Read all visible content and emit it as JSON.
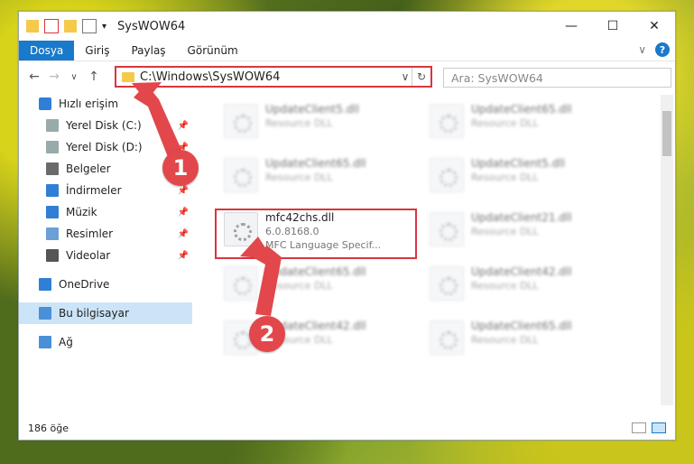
{
  "window": {
    "title": "SysWOW64",
    "minimize_symbol": "—",
    "maximize_symbol": "☐",
    "close_symbol": "✕"
  },
  "quick_access_icons": [
    "folder-icon",
    "properties-icon",
    "new-folder-icon",
    "checkbox-icon",
    "dropdown-icon"
  ],
  "ribbon": {
    "tabs": [
      "Dosya",
      "Giriş",
      "Paylaş",
      "Görünüm"
    ],
    "active_tab": "Dosya",
    "expand_symbol": "∨",
    "help_symbol": "?"
  },
  "navigation": {
    "back_symbol": "←",
    "forward_symbol": "→",
    "recent_symbol": "∨",
    "up_symbol": "↑",
    "address_path": "C:\\Windows\\SysWOW64",
    "address_drop_symbol": "∨",
    "refresh_symbol": "↻",
    "search_placeholder": "Ara: SysWOW64"
  },
  "sidebar": {
    "items": [
      {
        "label": "Hızlı erişim",
        "icon": "star-icon",
        "pinned": false,
        "indent": 1
      },
      {
        "label": "Yerel Disk (C:)",
        "icon": "drive-icon",
        "pinned": true,
        "indent": 2
      },
      {
        "label": "Yerel Disk (D:)",
        "icon": "drive-icon",
        "pinned": true,
        "indent": 2
      },
      {
        "label": "Belgeler",
        "icon": "document-icon",
        "pinned": true,
        "indent": 2
      },
      {
        "label": "İndirmeler",
        "icon": "download-icon",
        "pinned": true,
        "indent": 2
      },
      {
        "label": "Müzik",
        "icon": "music-icon",
        "pinned": true,
        "indent": 2
      },
      {
        "label": "Resimler",
        "icon": "picture-icon",
        "pinned": true,
        "indent": 2
      },
      {
        "label": "Videolar",
        "icon": "video-icon",
        "pinned": true,
        "indent": 2
      },
      {
        "label": "OneDrive",
        "icon": "cloud-icon",
        "pinned": false,
        "indent": 1
      },
      {
        "label": "Bu bilgisayar",
        "icon": "computer-icon",
        "pinned": false,
        "indent": 1,
        "selected": true
      },
      {
        "label": "Ağ",
        "icon": "network-icon",
        "pinned": false,
        "indent": 1
      }
    ]
  },
  "files": [
    {
      "name": "UpdateClient5.dll",
      "type": "Resource DLL",
      "blurred": true
    },
    {
      "name": "UpdateClient65.dll",
      "type": "Resource DLL",
      "blurred": true
    },
    {
      "name": "UpdateClient65.dll",
      "type": "Resource DLL",
      "blurred": true
    },
    {
      "name": "UpdateClient5.dll",
      "type": "Resource DLL",
      "blurred": true
    },
    {
      "name": "mfc42chs.dll",
      "version": "6.0.8168.0",
      "description": "MFC Language Specif...",
      "blurred": false
    },
    {
      "name": "UpdateClient21.dll",
      "type": "Resource DLL",
      "blurred": true
    },
    {
      "name": "UpdateClient65.dll",
      "type": "Resource DLL",
      "blurred": true
    },
    {
      "name": "UpdateClient42.dll",
      "type": "Resource DLL",
      "blurred": true
    },
    {
      "name": "UpdateClient42.dll",
      "type": "Resource DLL",
      "blurred": true
    },
    {
      "name": "UpdateClient65.dll",
      "type": "Resource DLL",
      "blurred": true
    }
  ],
  "status": {
    "item_count": "186 öğe"
  },
  "callouts": [
    "1",
    "2"
  ],
  "colors": {
    "accent": "#1979ca",
    "highlight": "#d9363e",
    "callout": "#e2474b"
  }
}
